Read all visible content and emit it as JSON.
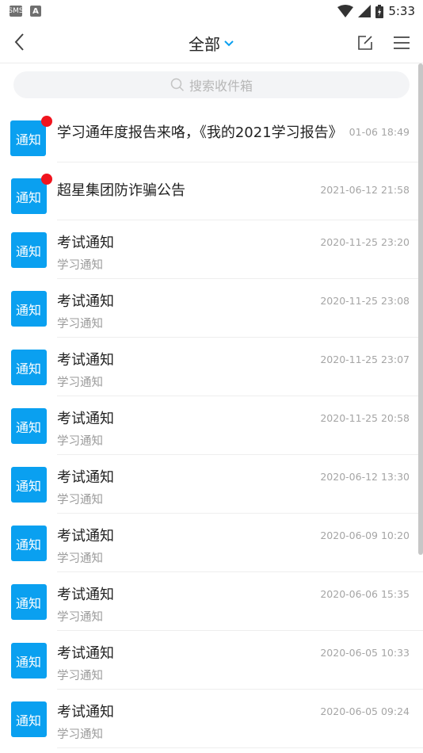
{
  "status_bar": {
    "left_icons": [
      "sms-icon",
      "a-icon"
    ],
    "left_labels": [
      "SMS",
      "A"
    ],
    "time": "5:33"
  },
  "header": {
    "title": "全部"
  },
  "search": {
    "placeholder": "搜索收件箱"
  },
  "colors": {
    "accent": "#0aa0f0",
    "badge": "#f0141e"
  },
  "messages": [
    {
      "avatar": "通知",
      "title": "学习通年度报告来咯，《我的2021学习报告》",
      "time": "01-06 18:49",
      "subtitle": "",
      "unread": true
    },
    {
      "avatar": "通知",
      "title": "超星集团防诈骗公告",
      "time": "2021-06-12 21:58",
      "subtitle": "",
      "unread": true
    },
    {
      "avatar": "通知",
      "title": "考试通知",
      "time": "2020-11-25 23:20",
      "subtitle": "学习通知",
      "unread": false
    },
    {
      "avatar": "通知",
      "title": "考试通知",
      "time": "2020-11-25 23:08",
      "subtitle": "学习通知",
      "unread": false
    },
    {
      "avatar": "通知",
      "title": "考试通知",
      "time": "2020-11-25 23:07",
      "subtitle": "学习通知",
      "unread": false
    },
    {
      "avatar": "通知",
      "title": "考试通知",
      "time": "2020-11-25 20:58",
      "subtitle": "学习通知",
      "unread": false
    },
    {
      "avatar": "通知",
      "title": "考试通知",
      "time": "2020-06-12 13:30",
      "subtitle": "学习通知",
      "unread": false
    },
    {
      "avatar": "通知",
      "title": "考试通知",
      "time": "2020-06-09 10:20",
      "subtitle": "学习通知",
      "unread": false
    },
    {
      "avatar": "通知",
      "title": "考试通知",
      "time": "2020-06-06 15:35",
      "subtitle": "学习通知",
      "unread": false
    },
    {
      "avatar": "通知",
      "title": "考试通知",
      "time": "2020-06-05 10:33",
      "subtitle": "学习通知",
      "unread": false
    },
    {
      "avatar": "通知",
      "title": "考试通知",
      "time": "2020-06-05 09:24",
      "subtitle": "学习通知",
      "unread": false
    }
  ]
}
